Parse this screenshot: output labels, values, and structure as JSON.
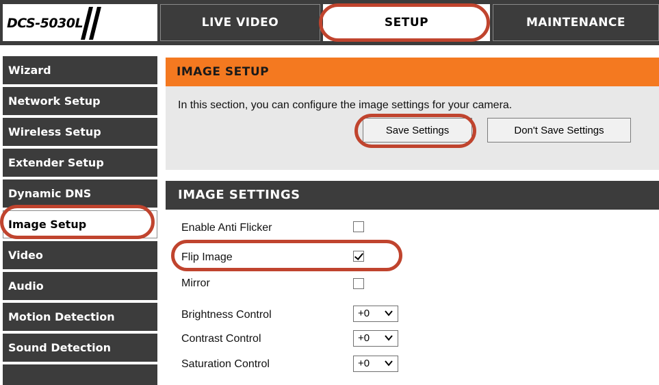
{
  "header": {
    "logo_text": "DCS-5030L",
    "tabs": [
      {
        "label": "LIVE VIDEO",
        "active": false
      },
      {
        "label": "SETUP",
        "active": true
      },
      {
        "label": "MAINTENANCE",
        "active": false
      }
    ]
  },
  "sidebar": {
    "items": [
      {
        "label": "Wizard",
        "active": false
      },
      {
        "label": "Network Setup",
        "active": false
      },
      {
        "label": "Wireless Setup",
        "active": false
      },
      {
        "label": "Extender Setup",
        "active": false
      },
      {
        "label": "Dynamic DNS",
        "active": false
      },
      {
        "label": "Image Setup",
        "active": true
      },
      {
        "label": "Video",
        "active": false
      },
      {
        "label": "Audio",
        "active": false
      },
      {
        "label": "Motion Detection",
        "active": false
      },
      {
        "label": "Sound Detection",
        "active": false
      }
    ]
  },
  "image_setup": {
    "title": "IMAGE SETUP",
    "description": "In this section, you can configure the image settings for your camera.",
    "save_label": "Save Settings",
    "dont_save_label": "Don't Save Settings"
  },
  "image_settings": {
    "title": "IMAGE SETTINGS",
    "enable_anti_flicker": {
      "label": "Enable Anti Flicker",
      "checked": false
    },
    "flip_image": {
      "label": "Flip Image",
      "checked": true
    },
    "mirror": {
      "label": "Mirror",
      "checked": false
    },
    "brightness": {
      "label": "Brightness Control",
      "value": "+0"
    },
    "contrast": {
      "label": "Contrast Control",
      "value": "+0"
    },
    "saturation": {
      "label": "Saturation Control",
      "value": "+0"
    }
  },
  "colors": {
    "nav_bg": "#3c3c3c",
    "accent_orange": "#f47920",
    "highlight_red": "#c0442e",
    "panel_gray": "#e8e8e8"
  }
}
